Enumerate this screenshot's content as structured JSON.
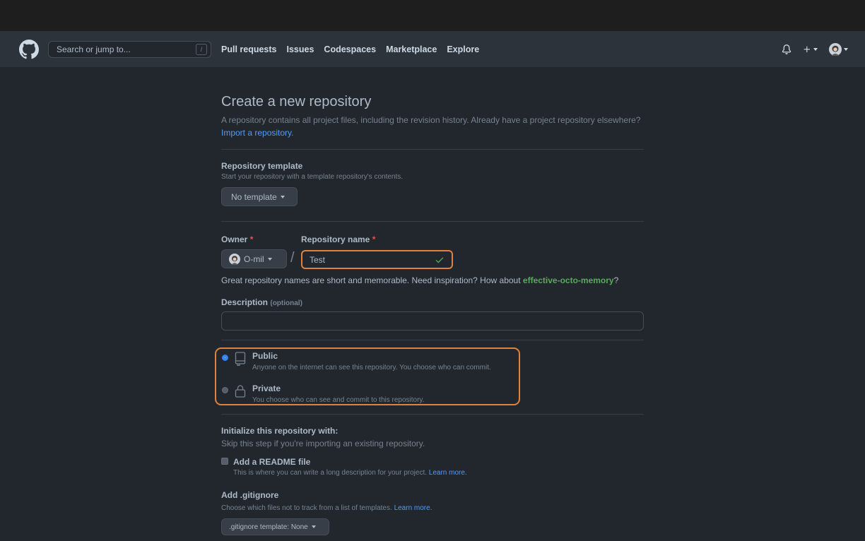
{
  "header": {
    "search_placeholder": "Search or jump to...",
    "search_shortcut": "/",
    "nav": [
      "Pull requests",
      "Issues",
      "Codespaces",
      "Marketplace",
      "Explore"
    ]
  },
  "page": {
    "title": "Create a new repository",
    "subtitle": "A repository contains all project files, including the revision history. Already have a project repository elsewhere?",
    "import_link": "Import a repository."
  },
  "template": {
    "label": "Repository template",
    "note": "Start your repository with a template repository's contents.",
    "button": "No template"
  },
  "owner": {
    "label": "Owner",
    "required_mark": "*",
    "value": "O-mil"
  },
  "repo_name": {
    "label": "Repository name",
    "required_mark": "*",
    "value": "Test",
    "separator": "/"
  },
  "suggestion": {
    "text": "Great repository names are short and memorable. Need inspiration? How about",
    "name": "effective-octo-memory",
    "end": "?"
  },
  "description": {
    "label": "Description",
    "optional": "(optional)",
    "value": ""
  },
  "visibility": {
    "public_label": "Public",
    "public_note": "Anyone on the internet can see this repository. You choose who can commit.",
    "private_label": "Private",
    "private_note": "You choose who can see and commit to this repository."
  },
  "init": {
    "title": "Initialize this repository with:",
    "note": "Skip this step if you're importing an existing repository.",
    "readme_label": "Add a README file",
    "readme_note": "This is where you can write a long description for your project.",
    "readme_link": "Learn more."
  },
  "gitignore": {
    "label": "Add .gitignore",
    "note": "Choose which files not to track from a list of templates.",
    "link": "Learn more.",
    "button": ".gitignore template: None"
  },
  "colors": {
    "accent_highlight": "#e0823d",
    "link": "#539bf5",
    "success": "#57ab5a",
    "danger": "#e5534b"
  }
}
